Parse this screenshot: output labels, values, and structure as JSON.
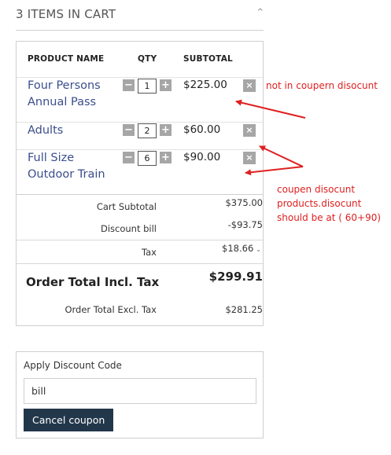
{
  "cart": {
    "title": "3 ITEMS IN CART",
    "collapse_symbol": "^",
    "headers": {
      "product": "PRODUCT NAME",
      "qty": "QTY",
      "subtotal": "SUBTOTAL"
    },
    "items": [
      {
        "name": "Four Persons Annual Pass",
        "qty": "1",
        "price": "$225.00"
      },
      {
        "name": "Adults",
        "qty": "2",
        "price": "$60.00"
      },
      {
        "name": "Full Size Outdoor Train",
        "qty": "6",
        "price": "$90.00"
      }
    ],
    "minus_symbol": "−",
    "plus_symbol": "+",
    "remove_symbol": "×",
    "summary": {
      "cart_subtotal_label": "Cart Subtotal",
      "cart_subtotal_value": "$375.00",
      "discount_label": "Discount bill",
      "discount_value": "-$93.75",
      "tax_label": "Tax",
      "tax_value": "$18.66",
      "tax_toggle_symbol": "⌄",
      "total_incl_label": "Order Total Incl. Tax",
      "total_incl_value": "$299.91",
      "total_excl_label": "Order Total Excl. Tax",
      "total_excl_value": "$281.25"
    }
  },
  "discount": {
    "label": "Apply Discount Code",
    "code_value": "bill",
    "cancel_label": "Cancel coupon"
  },
  "annotations": {
    "note1": "not in coupern disocunt",
    "note2_lines": [
      "coupen disocunt",
      "products.disocunt",
      "should be at ( 60+90)"
    ],
    "color": "#e02020"
  }
}
